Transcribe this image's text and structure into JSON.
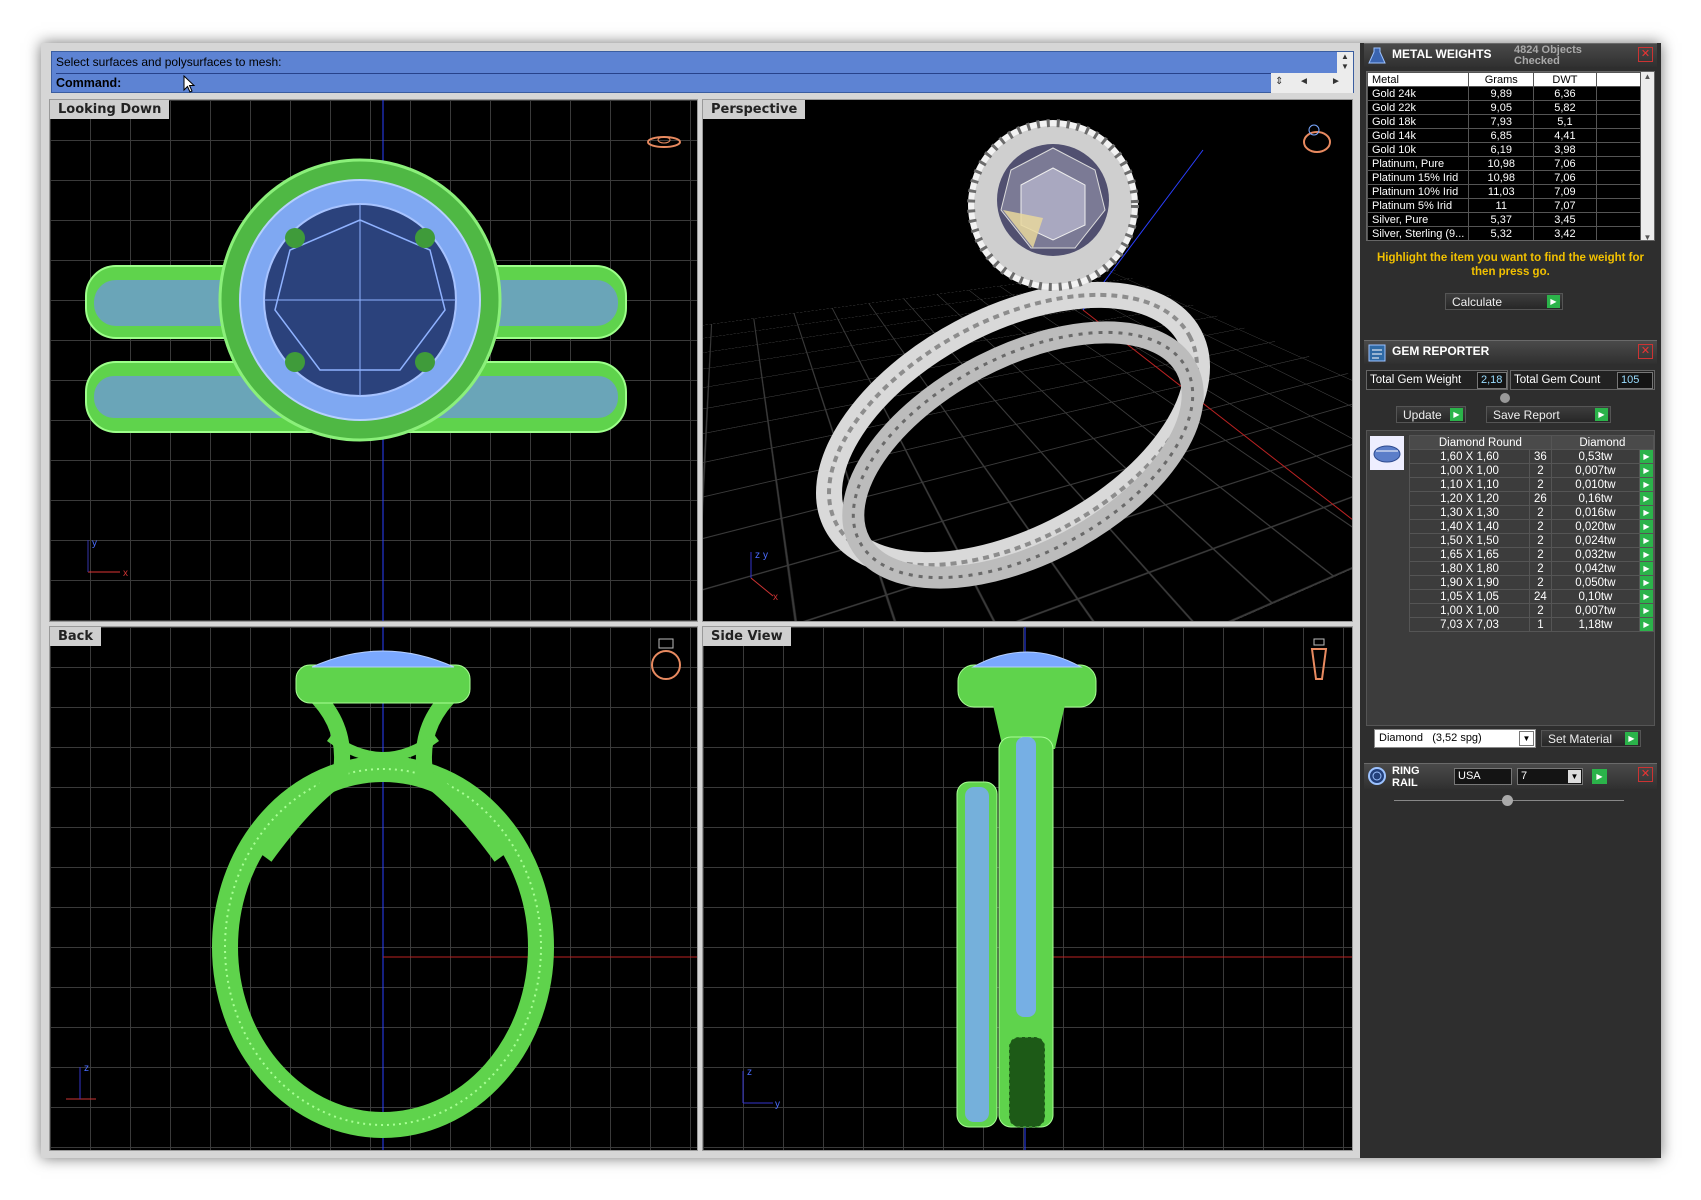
{
  "command": {
    "prompt": "Select surfaces and polysurfaces to mesh:",
    "label": "Command:",
    "scroll_up": "▲",
    "scroll_down": "▼",
    "nav_prev": "◄",
    "nav_next": "►"
  },
  "viewports": {
    "top": "Looking Down",
    "perspective": "Perspective",
    "back": "Back",
    "side": "Side View"
  },
  "metal_weights": {
    "title": "METAL WEIGHTS",
    "objects_checked": "4824 Objects Checked",
    "columns": [
      "Metal",
      "Grams",
      "DWT"
    ],
    "rows": [
      [
        "Gold 24k",
        "9,89",
        "6,36"
      ],
      [
        "Gold 22k",
        "9,05",
        "5,82"
      ],
      [
        "Gold 18k",
        "7,93",
        "5,1"
      ],
      [
        "Gold 14k",
        "6,85",
        "4,41"
      ],
      [
        "Gold 10k",
        "6,19",
        "3,98"
      ],
      [
        "Platinum, Pure",
        "10,98",
        "7,06"
      ],
      [
        "Platinum 15% Irid",
        "10,98",
        "7,06"
      ],
      [
        "Platinum 10% Irid",
        "11,03",
        "7,09"
      ],
      [
        "Platinum 5% Irid",
        "11",
        "7,07"
      ],
      [
        "Silver, Pure",
        "5,37",
        "3,45"
      ],
      [
        "Silver, Sterling (9...",
        "5,32",
        "3,42"
      ]
    ],
    "hint": "Highlight the item you want to find the weight for then press go.",
    "calculate": "Calculate"
  },
  "gem_reporter": {
    "title": "GEM REPORTER",
    "total_weight_label": "Total Gem Weight",
    "total_weight": "2,18",
    "total_count_label": "Total Gem Count",
    "total_count": "105",
    "update": "Update",
    "save_report": "Save Report",
    "columns": [
      "Diamond Round",
      "Diamond"
    ],
    "rows": [
      [
        "1,60 X 1,60",
        "36",
        "0,53tw"
      ],
      [
        "1,00 X 1,00",
        "2",
        "0,007tw"
      ],
      [
        "1,10 X 1,10",
        "2",
        "0,010tw"
      ],
      [
        "1,20 X 1,20",
        "26",
        "0,16tw"
      ],
      [
        "1,30 X 1,30",
        "2",
        "0,016tw"
      ],
      [
        "1,40 X 1,40",
        "2",
        "0,020tw"
      ],
      [
        "1,50 X 1,50",
        "2",
        "0,024tw"
      ],
      [
        "1,65 X 1,65",
        "2",
        "0,032tw"
      ],
      [
        "1,80 X 1,80",
        "2",
        "0,042tw"
      ],
      [
        "1,90 X 1,90",
        "2",
        "0,050tw"
      ],
      [
        "1,05 X 1,05",
        "24",
        "0,10tw"
      ],
      [
        "1,00 X 1,00",
        "2",
        "0,007tw"
      ],
      [
        "7,03 X 7,03",
        "1",
        "1,18tw"
      ]
    ],
    "material": "Diamond   (3,52 spg)",
    "set_material": "Set Material"
  },
  "ring_rail": {
    "title": "RING RAIL",
    "region": "USA",
    "size": "7"
  },
  "colors": {
    "wire_green": "#7dff6b",
    "wire_blue": "#7aa8ff",
    "command_bar": "#5d83d3",
    "go_green": "#2bb34a",
    "hint_yellow": "#f2c100"
  },
  "icons": [
    "cursor-arrow-icon",
    "ring-preview-icon",
    "metal-flask-icon",
    "gem-reporter-icon",
    "ring-rail-icon",
    "close-icon",
    "go-arrow-icon",
    "dropdown-arrow-icon"
  ]
}
